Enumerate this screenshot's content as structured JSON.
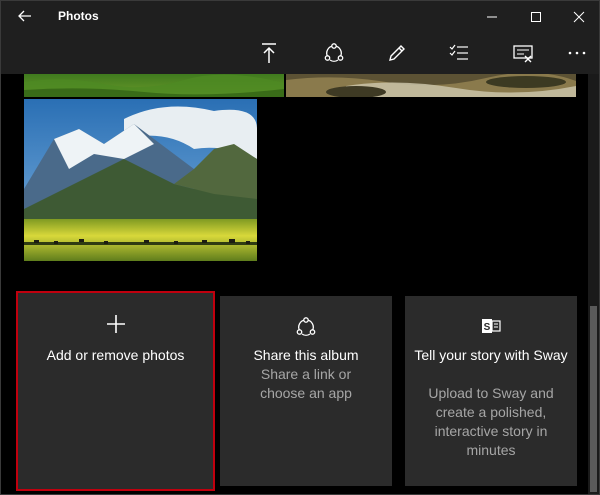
{
  "window": {
    "title": "Photos"
  },
  "titlebar": {
    "back_icon": "back-arrow-icon",
    "minimize_icon": "minimize-icon",
    "maximize_icon": "maximize-icon",
    "close_icon": "close-icon"
  },
  "toolbar": {
    "items": [
      {
        "name": "set-as-cover",
        "icon": "upload-arrow-icon"
      },
      {
        "name": "share",
        "icon": "share-icon"
      },
      {
        "name": "edit",
        "icon": "pencil-icon"
      },
      {
        "name": "select",
        "icon": "checklist-icon"
      },
      {
        "name": "remove",
        "icon": "slideshow-remove-icon"
      },
      {
        "name": "more",
        "icon": "more-icon"
      }
    ]
  },
  "cards": {
    "add": {
      "title": "Add or remove photos",
      "icon": "plus-icon"
    },
    "share": {
      "title": "Share this album",
      "subtitle": "Share a link or choose an app",
      "icon": "share-icon"
    },
    "sway": {
      "title": "Tell your story with Sway",
      "subtitle": "Upload to Sway and create a polished, interactive story in minutes",
      "icon": "sway-icon"
    }
  },
  "colors": {
    "titlebar": "#1f1f1f",
    "card": "#2b2b2b",
    "selection": "#c0000e",
    "subtitle": "#a6a6a6"
  }
}
